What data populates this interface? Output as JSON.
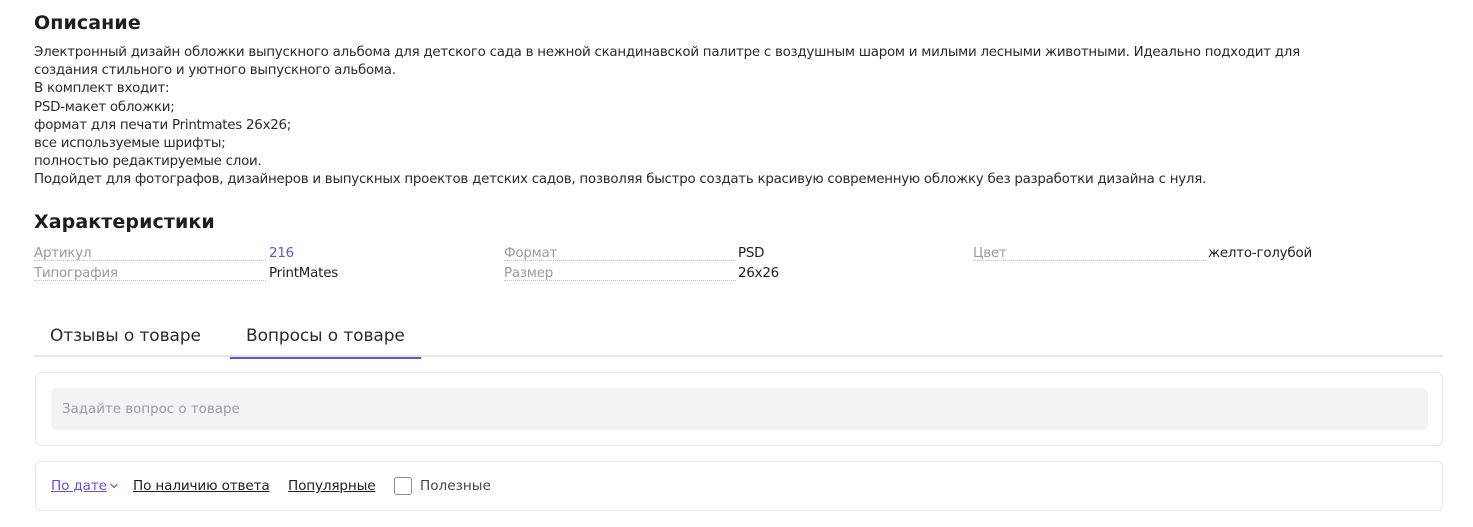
{
  "description": {
    "title": "Описание",
    "lines": [
      "Электронный дизайн обложки выпускного альбома для детского сада в нежной скандинавской палитре с воздушным шаром и милыми лесными животными. Идеально подходит для",
      "создания стильного и уютного выпускного альбома.",
      "В комплект входит:",
      "PSD-макет обложки;",
      "формат для печати Printmates 26х26;",
      "все используемые шрифты;",
      "полностью редактируемые слои.",
      "Подойдет для фотографов, дизайнеров и выпускных проектов детских садов, позволяя быстро создать красивую современную обложку без разработки дизайна с нуля."
    ]
  },
  "specs": {
    "title": "Характеристики",
    "items": [
      {
        "key": "Артикул",
        "value": "216"
      },
      {
        "key": "Типография",
        "value": "PrintMates"
      },
      {
        "key": "Формат",
        "value": "PSD"
      },
      {
        "key": "Размер",
        "value": "26x26"
      },
      {
        "key": "Цвет",
        "value": "желто-голубой"
      }
    ]
  },
  "tabs": [
    {
      "label": "Отзывы о товаре",
      "active": false
    },
    {
      "label": "Вопросы о товаре",
      "active": true
    }
  ],
  "question": {
    "placeholder": "Задайте вопрос о товаре",
    "value": ""
  },
  "filters": {
    "sort_by_date": "По дате",
    "by_answer": "По наличию ответа",
    "popular": "Популярные",
    "useful_label": "Полезные",
    "useful_checked": false
  },
  "colors": {
    "accent": "#6a4fd3",
    "muted_text": "#9a9a9a",
    "input_bg": "#f3f3f6",
    "border": "#e6e6ea"
  },
  "icons": {
    "sort_chevron": "chevron-down-icon",
    "useful_checkbox": "checkbox-icon"
  }
}
